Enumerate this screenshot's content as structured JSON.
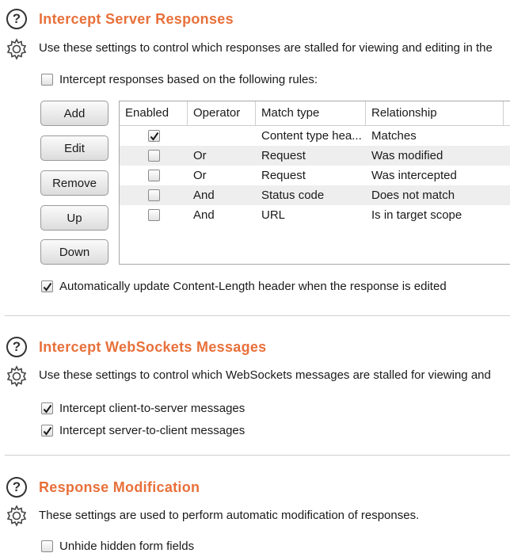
{
  "sections": {
    "intercept_responses": {
      "title": "Intercept Server Responses",
      "description": "Use these settings to control which responses are stalled for viewing and editing in the",
      "rules_checkbox_label": "Intercept responses based on the following rules:",
      "rules_checked": false,
      "buttons": {
        "add": "Add",
        "edit": "Edit",
        "remove": "Remove",
        "up": "Up",
        "down": "Down"
      },
      "table": {
        "columns": [
          "Enabled",
          "Operator",
          "Match type",
          "Relationship"
        ],
        "rows": [
          {
            "enabled": true,
            "operator": "",
            "match_type": "Content type hea...",
            "relationship": "Matches"
          },
          {
            "enabled": false,
            "operator": "Or",
            "match_type": "Request",
            "relationship": "Was modified"
          },
          {
            "enabled": false,
            "operator": "Or",
            "match_type": "Request",
            "relationship": "Was intercepted"
          },
          {
            "enabled": false,
            "operator": "And",
            "match_type": "Status code",
            "relationship": "Does not match"
          },
          {
            "enabled": false,
            "operator": "And",
            "match_type": "URL",
            "relationship": "Is in target scope"
          }
        ]
      },
      "auto_update_label": "Automatically update Content-Length header when the response is edited",
      "auto_update_checked": true
    },
    "intercept_websockets": {
      "title": "Intercept WebSockets Messages",
      "description": "Use these settings to control which WebSockets messages are stalled for viewing and",
      "client_to_server_label": "Intercept client-to-server messages",
      "client_to_server_checked": true,
      "server_to_client_label": "Intercept server-to-client messages",
      "server_to_client_checked": true
    },
    "response_modification": {
      "title": "Response Modification",
      "description": "These settings are used to perform automatic modification of responses.",
      "unhide_label": "Unhide hidden form fields",
      "unhide_checked": false
    }
  },
  "icons": {
    "help": "help-icon",
    "settings": "gear-icon",
    "check": "checkmark-icon"
  },
  "colors": {
    "section_title": "#e8703a",
    "row_alt": "#eeeeee"
  }
}
